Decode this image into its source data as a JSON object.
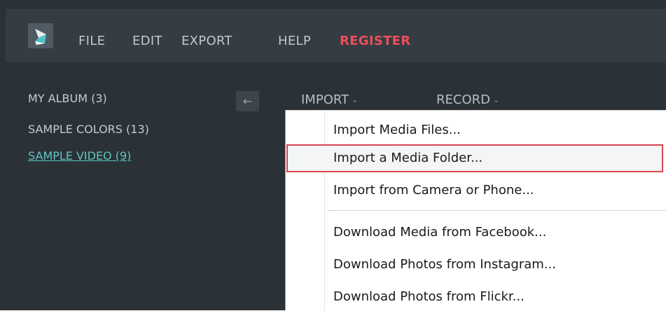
{
  "menubar": {
    "logo_icon": "filmora-logo-icon",
    "items": [
      "FILE",
      "EDIT",
      "EXPORT",
      "HELP"
    ],
    "register_label": "REGISTER"
  },
  "albums": {
    "items": [
      "MY ALBUM (3)",
      "SAMPLE COLORS (13)",
      "SAMPLE VIDEO (9)"
    ],
    "active_index": 2
  },
  "toolbar": {
    "collapse_icon": "←",
    "import_label": "IMPORT",
    "record_label": "RECORD",
    "chevron": "⌄"
  },
  "import_menu": {
    "items": [
      "Import Media Files...",
      "Import a Media Folder...",
      "Import from Camera or Phone...",
      "Download Media from Facebook...",
      "Download Photos from Instagram...",
      "Download Photos from Flickr..."
    ],
    "highlighted_index": 1
  },
  "colors": {
    "app_background": "#2b3237",
    "menubar_background": "#353c42",
    "register": "#e8505a",
    "active_album": "#5fc4c0",
    "highlight_border": "#d9464c"
  }
}
